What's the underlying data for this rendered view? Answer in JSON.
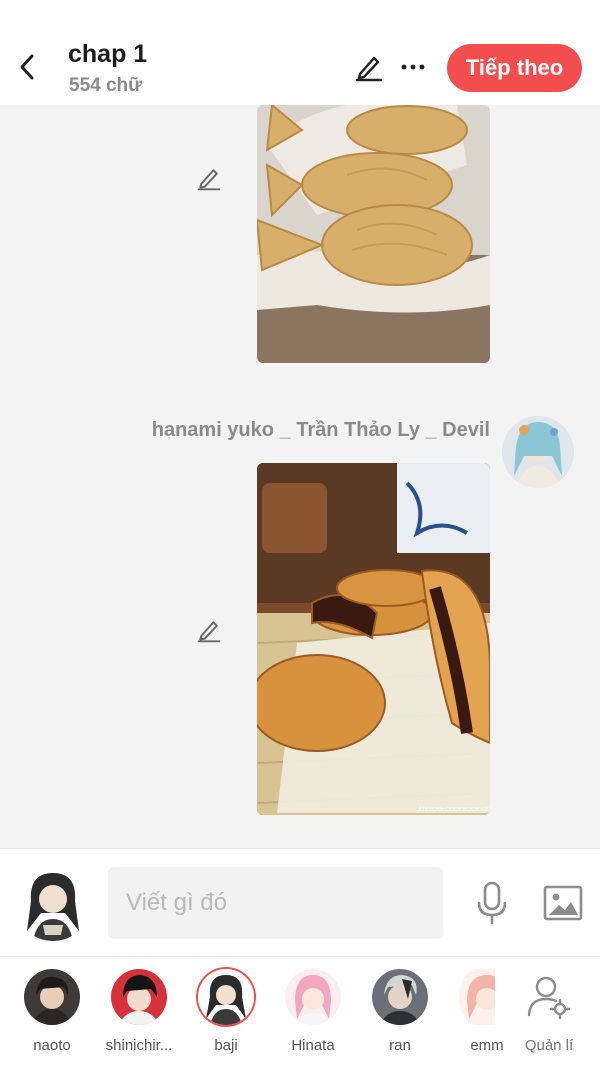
{
  "header": {
    "title": "chap 1",
    "word_count": "554 chữ",
    "next_label": "Tiếp theo",
    "icons": [
      "back-arrow-icon",
      "pencil-icon",
      "more-icon"
    ]
  },
  "messages": [
    {
      "type": "image",
      "subject": "taiyaki",
      "has_edit": true
    },
    {
      "type": "image",
      "subject": "dorayaki",
      "sender": "hanami yuko _ Trần Thảo Ly _ Devil",
      "has_edit": true
    }
  ],
  "composer": {
    "placeholder": "Viết gì đó",
    "icons": [
      "microphone-icon",
      "image-icon"
    ]
  },
  "characters": [
    {
      "name": "naoto",
      "selected": false
    },
    {
      "name": "shinichir...",
      "selected": false
    },
    {
      "name": "baji",
      "selected": true
    },
    {
      "name": "Hinata",
      "selected": false
    },
    {
      "name": "ran",
      "selected": false
    },
    {
      "name": "emm",
      "selected": false
    }
  ],
  "manage_label": "Quản lí",
  "colors": {
    "accent": "#f24d4f",
    "background": "#f3f3f3",
    "muted_text": "#8a8a8a"
  }
}
